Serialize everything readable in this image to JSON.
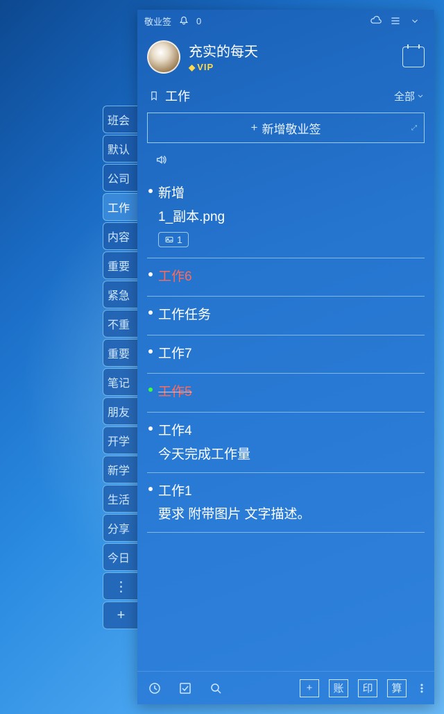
{
  "titlebar": {
    "app_name": "敬业签",
    "notif_count": "0"
  },
  "profile": {
    "username": "充实的每天",
    "vip_label": "VIP"
  },
  "category": {
    "icon": "bookmark-icon",
    "name": "工作",
    "filter_label": "全部"
  },
  "add_button": {
    "label": "新增敬业签"
  },
  "side_tabs": [
    "班会",
    "默认",
    "公司",
    "工作",
    "内容",
    "重要",
    "紧急",
    "不重",
    "重要",
    "笔记",
    "朋友",
    "开学",
    "新学",
    "生活",
    "分享",
    "今日"
  ],
  "side_active_index": 3,
  "notes": [
    {
      "title": "新增",
      "sub": "1_副本.png",
      "attachment_count": "1",
      "color": "white",
      "strike": false,
      "dot": "white"
    },
    {
      "title": "工作6",
      "color": "red",
      "strike": false,
      "dot": "white"
    },
    {
      "title": "工作任务",
      "color": "white",
      "strike": false,
      "dot": "white"
    },
    {
      "title": "工作7",
      "color": "white",
      "strike": false,
      "dot": "white"
    },
    {
      "title": "工作5",
      "color": "red",
      "strike": true,
      "dot": "green"
    },
    {
      "title": "工作4",
      "sub": "今天完成工作量",
      "color": "white",
      "strike": false,
      "dot": "white"
    },
    {
      "title": "工作1",
      "sub": "要求  附带图片 文字描述。",
      "color": "white",
      "strike": false,
      "dot": "white"
    }
  ],
  "bottom": {
    "btn_add": "+",
    "btn_account": "账",
    "btn_print": "印",
    "btn_calc": "算"
  }
}
